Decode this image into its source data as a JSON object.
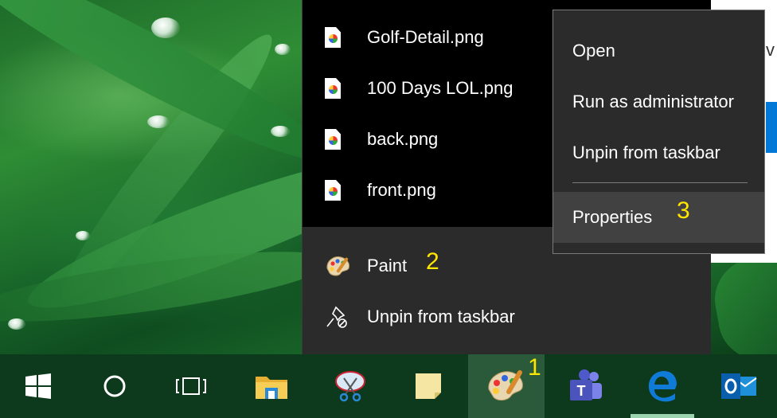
{
  "jumplist": {
    "recent": [
      {
        "label": "Golf-Detail.png",
        "icon": "png-file-icon"
      },
      {
        "label": "100 Days LOL.png",
        "icon": "png-file-icon"
      },
      {
        "label": "back.png",
        "icon": "png-file-icon"
      },
      {
        "label": "front.png",
        "icon": "png-file-icon"
      }
    ],
    "tasks": [
      {
        "label": "Paint",
        "icon": "paint-icon"
      },
      {
        "label": "Unpin from taskbar",
        "icon": "unpin-icon"
      }
    ]
  },
  "context_menu": {
    "items": [
      "Open",
      "Run as administrator",
      "Unpin from taskbar",
      "Properties"
    ]
  },
  "annotations": {
    "step1": "1",
    "step2": "2",
    "step3": "3"
  },
  "background_window": {
    "partial_text": "v"
  },
  "taskbar": {
    "buttons": [
      {
        "name": "start",
        "icon": "windows-logo-icon"
      },
      {
        "name": "search",
        "icon": "cortana-circle-icon"
      },
      {
        "name": "task-view",
        "icon": "task-view-icon"
      },
      {
        "name": "file-explorer",
        "icon": "folder-icon"
      },
      {
        "name": "snipping-tool",
        "icon": "scissors-icon"
      },
      {
        "name": "sticky-notes",
        "icon": "sticky-note-icon"
      },
      {
        "name": "paint",
        "icon": "paint-icon"
      },
      {
        "name": "teams",
        "icon": "teams-icon"
      },
      {
        "name": "edge",
        "icon": "edge-icon"
      },
      {
        "name": "outlook",
        "icon": "outlook-icon"
      }
    ]
  },
  "colors": {
    "accent_yellow": "#ffe600",
    "menu_bg": "#2b2b2b",
    "taskbar_bg": "#0d3a1c"
  }
}
